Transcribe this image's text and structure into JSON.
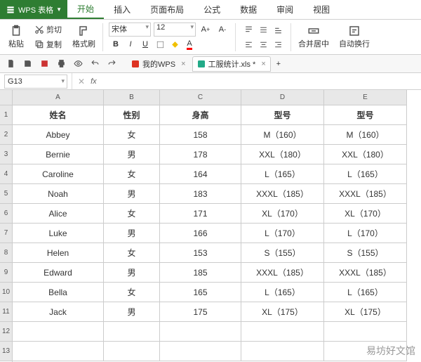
{
  "app": {
    "name": "WPS 表格"
  },
  "menu_tabs": [
    "开始",
    "插入",
    "页面布局",
    "公式",
    "数据",
    "审阅",
    "视图"
  ],
  "clipboard": {
    "cut": "剪切",
    "copy": "复制",
    "paste": "粘贴",
    "format_painter": "格式刷"
  },
  "font": {
    "family": "宋体",
    "size": "12"
  },
  "align_group": {
    "merge": "合并居中",
    "wrap": "自动换行"
  },
  "doc_tabs": [
    {
      "label": "我的WPS"
    },
    {
      "label": "工服统计.xls *"
    }
  ],
  "name_box": "G13",
  "col_headers": [
    "A",
    "B",
    "C",
    "D",
    "E"
  ],
  "row_headers": [
    "1",
    "2",
    "3",
    "4",
    "5",
    "6",
    "7",
    "8",
    "9",
    "10",
    "11",
    "12",
    "13"
  ],
  "table": {
    "headers": [
      "姓名",
      "性别",
      "身高",
      "型号",
      "型号"
    ],
    "rows": [
      [
        "Abbey",
        "女",
        "158",
        "M（160）",
        "M（160）"
      ],
      [
        "Bernie",
        "男",
        "178",
        "XXL（180）",
        "XXL（180）"
      ],
      [
        "Caroline",
        "女",
        "164",
        "L（165）",
        "L（165）"
      ],
      [
        "Noah",
        "男",
        "183",
        "XXXL（185）",
        "XXXL（185）"
      ],
      [
        "Alice",
        "女",
        "171",
        "XL（170）",
        "XL（170）"
      ],
      [
        "Luke",
        "男",
        "166",
        "L（170）",
        "L（170）"
      ],
      [
        "Helen",
        "女",
        "153",
        "S（155）",
        "S（155）"
      ],
      [
        "Edward",
        "男",
        "185",
        "XXXL（185）",
        "XXXL（185）"
      ],
      [
        "Bella",
        "女",
        "165",
        "L（165）",
        "L（165）"
      ],
      [
        "Jack",
        "男",
        "175",
        "XL（175）",
        "XL（175）"
      ]
    ]
  },
  "watermark": "易坊好文馆"
}
